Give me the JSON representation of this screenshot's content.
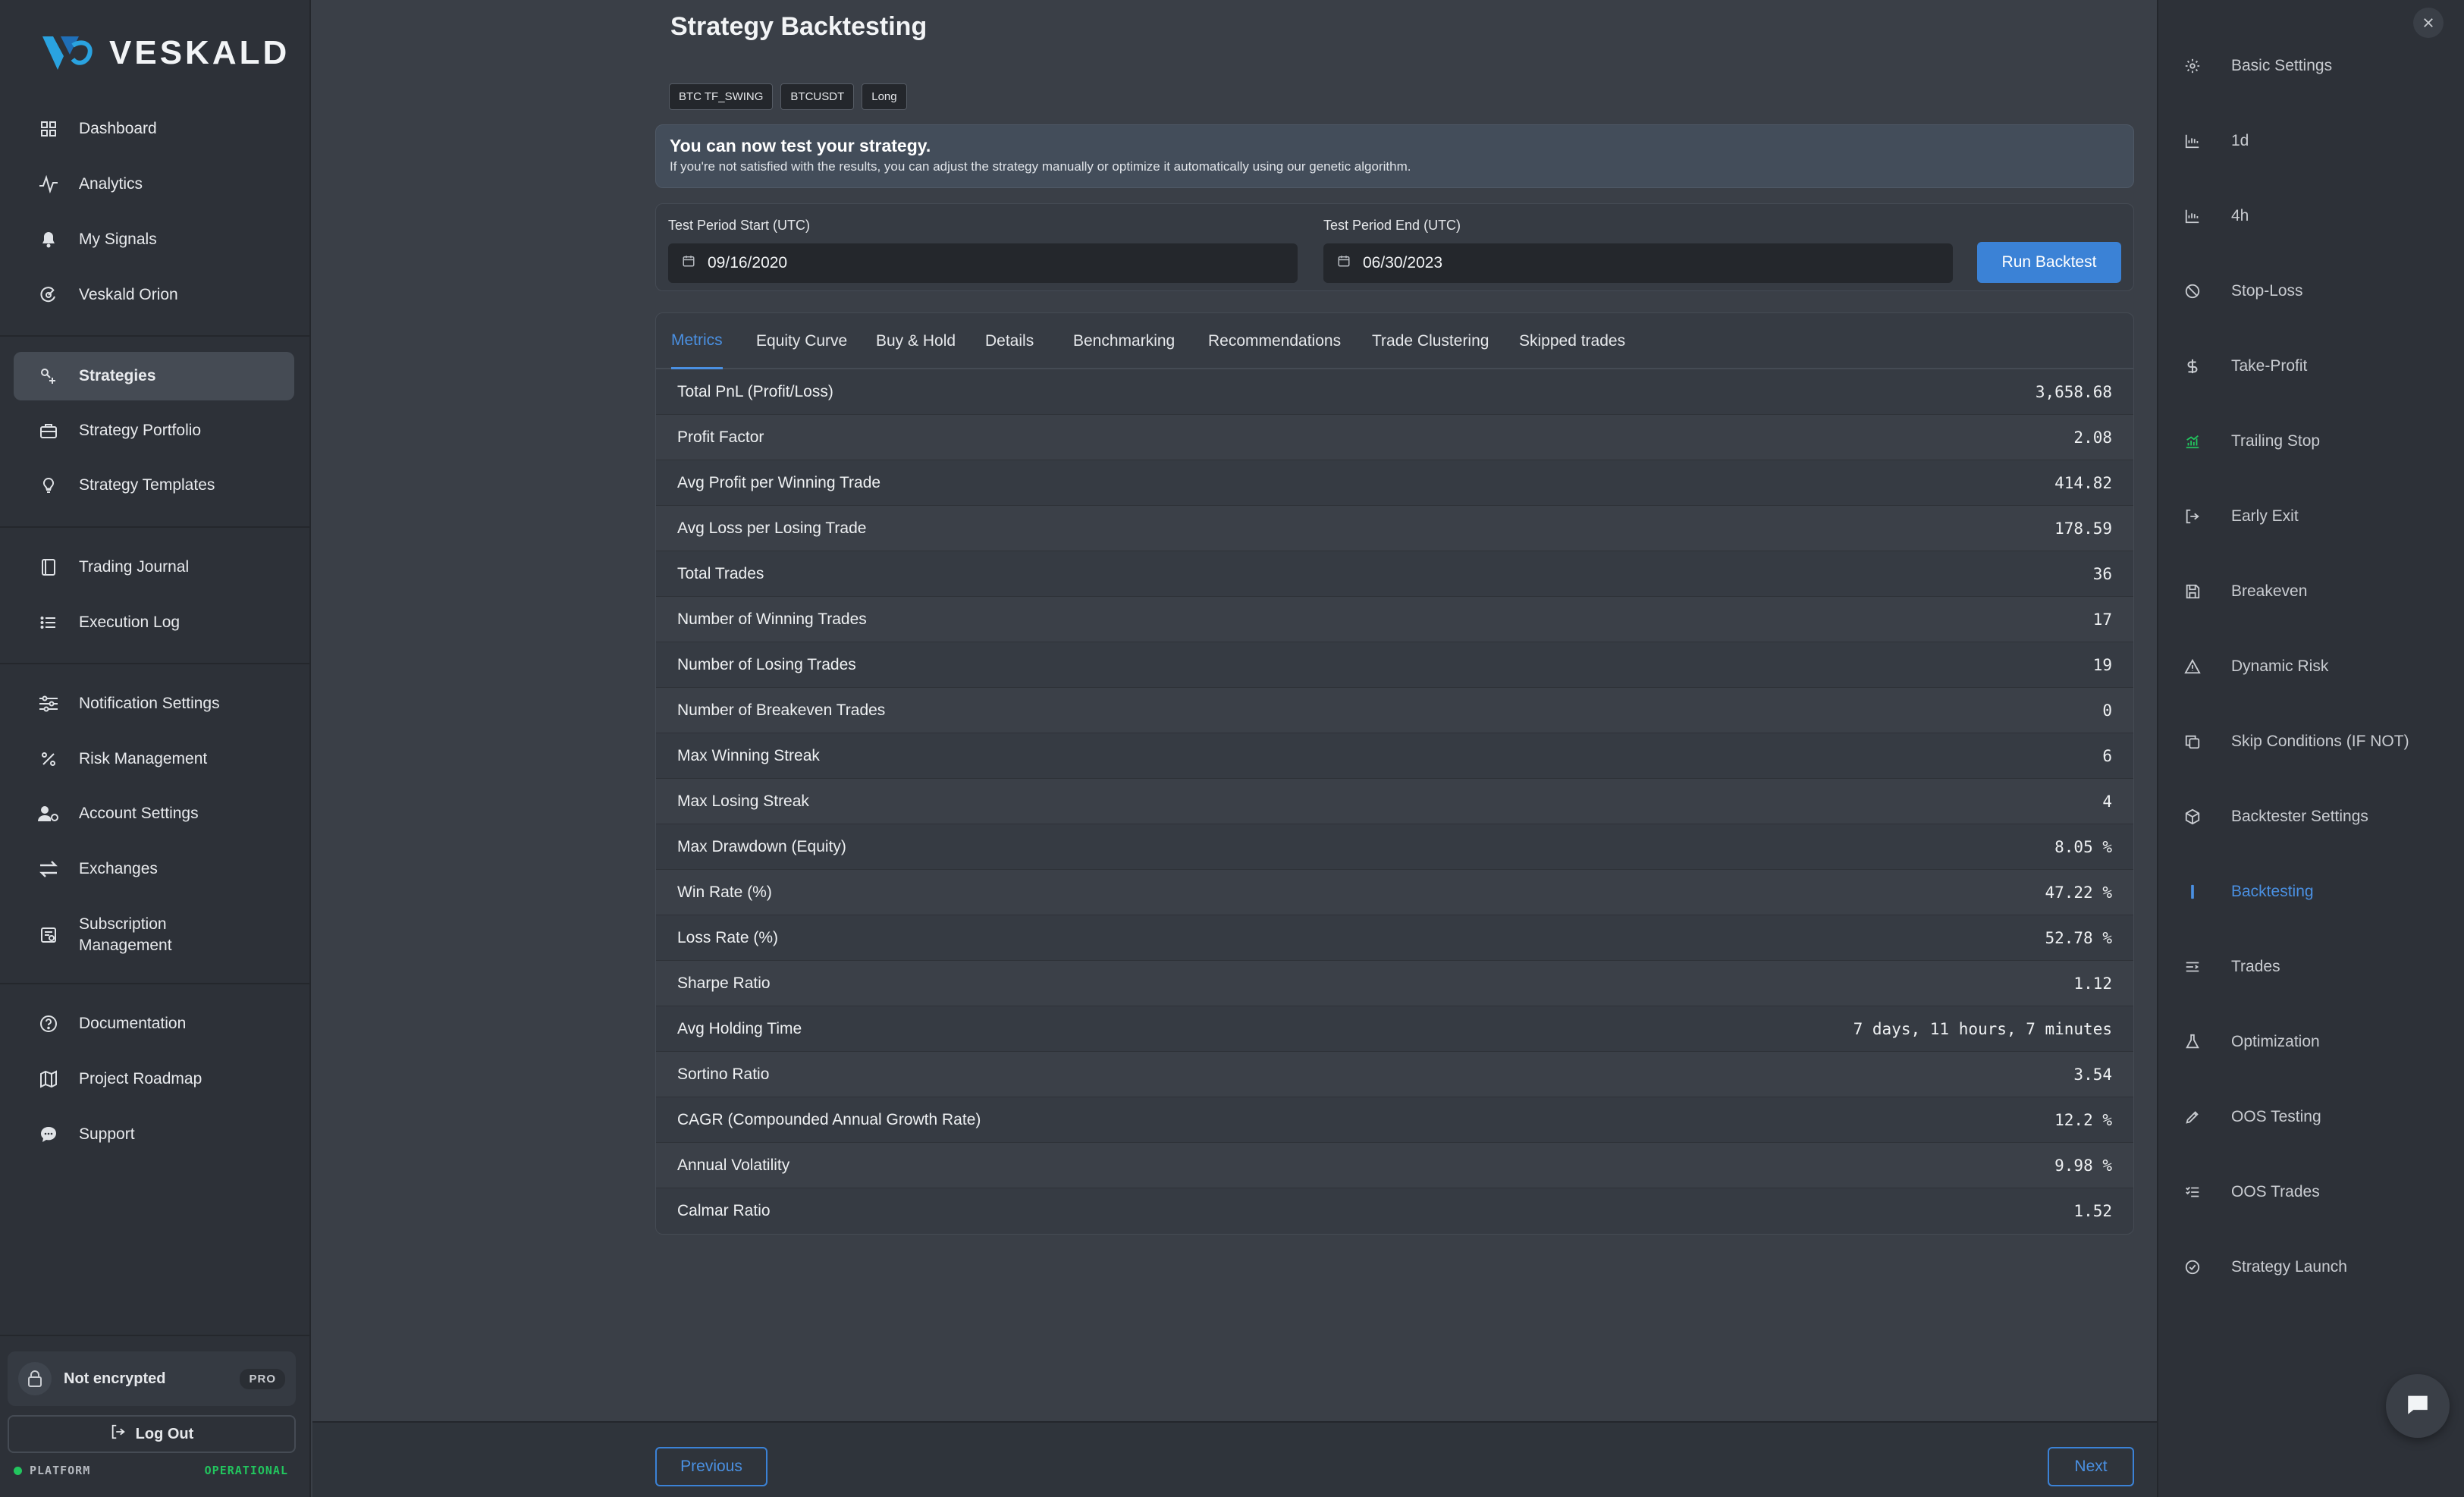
{
  "brand": {
    "name": "VESKALD"
  },
  "sidebar": {
    "items": [
      {
        "label": "Dashboard",
        "icon": "dashboard-icon"
      },
      {
        "label": "Analytics",
        "icon": "analytics-icon"
      },
      {
        "label": "My Signals",
        "icon": "bell-icon"
      },
      {
        "label": "Veskald Orion",
        "icon": "orion-icon"
      },
      {
        "label": "Strategies",
        "icon": "strategies-icon",
        "active": true
      },
      {
        "label": "Strategy Portfolio",
        "icon": "briefcase-icon"
      },
      {
        "label": "Strategy Templates",
        "icon": "lightbulb-icon"
      },
      {
        "label": "Trading Journal",
        "icon": "journal-icon"
      },
      {
        "label": "Execution Log",
        "icon": "list-icon"
      },
      {
        "label": "Notification Settings",
        "icon": "sliders-icon"
      },
      {
        "label": "Risk Management",
        "icon": "percent-icon"
      },
      {
        "label": "Account Settings",
        "icon": "user-gear-icon"
      },
      {
        "label": "Exchanges",
        "icon": "exchange-icon"
      },
      {
        "label": "Subscription Management",
        "icon": "subscription-icon"
      },
      {
        "label": "Documentation",
        "icon": "help-circle-icon"
      },
      {
        "label": "Project Roadmap",
        "icon": "map-icon"
      },
      {
        "label": "Support",
        "icon": "chat-icon"
      }
    ],
    "encryption": {
      "label": "Not encrypted",
      "badge": "PRO"
    },
    "logout_label": "Log Out",
    "status": {
      "left": "PLATFORM",
      "right": "OPERATIONAL",
      "color": "#22c55e"
    }
  },
  "main": {
    "title": "Strategy Backtesting",
    "tags": [
      "BTC TF_SWING",
      "BTCUSDT",
      "Long"
    ],
    "info": {
      "title": "You can now test your strategy.",
      "subtitle": "If you're not satisfied with the results, you can adjust the strategy manually or optimize it automatically using our genetic algorithm."
    },
    "dates": {
      "start_label": "Test Period Start (UTC)",
      "start_value": "09/16/2020",
      "end_label": "Test Period End (UTC)",
      "end_value": "06/30/2023",
      "run_label": "Run Backtest"
    },
    "tabs": [
      "Metrics",
      "Equity Curve",
      "Buy & Hold",
      "Details",
      "Benchmarking",
      "Recommendations",
      "Trade Clustering",
      "Skipped trades"
    ],
    "active_tab": "Metrics",
    "metrics": [
      {
        "label": "Total PnL (Profit/Loss)",
        "value": "3,658.68"
      },
      {
        "label": "Profit Factor",
        "value": "2.08"
      },
      {
        "label": "Avg Profit per Winning Trade",
        "value": "414.82"
      },
      {
        "label": "Avg Loss per Losing Trade",
        "value": "178.59"
      },
      {
        "label": "Total Trades",
        "value": "36"
      },
      {
        "label": "Number of Winning Trades",
        "value": "17"
      },
      {
        "label": "Number of Losing Trades",
        "value": "19"
      },
      {
        "label": "Number of Breakeven Trades",
        "value": "0"
      },
      {
        "label": "Max Winning Streak",
        "value": "6"
      },
      {
        "label": "Max Losing Streak",
        "value": "4"
      },
      {
        "label": "Max Drawdown (Equity)",
        "value": "8.05 %"
      },
      {
        "label": "Win Rate (%)",
        "value": "47.22 %"
      },
      {
        "label": "Loss Rate (%)",
        "value": "52.78 %"
      },
      {
        "label": "Sharpe Ratio",
        "value": "1.12"
      },
      {
        "label": "Avg Holding Time",
        "value": "7 days, 11 hours, 7 minutes"
      },
      {
        "label": "Sortino Ratio",
        "value": "3.54"
      },
      {
        "label": "CAGR (Compounded Annual Growth Rate)",
        "value": "12.2 %"
      },
      {
        "label": "Annual Volatility",
        "value": "9.98 %"
      },
      {
        "label": "Calmar Ratio",
        "value": "1.52"
      }
    ],
    "previous_label": "Previous",
    "next_label": "Next",
    "accent": "#3b82d6"
  },
  "steps": {
    "items": [
      {
        "label": "Basic Settings",
        "icon": "gear-icon"
      },
      {
        "label": "1d",
        "icon": "chart-icon"
      },
      {
        "label": "4h",
        "icon": "chart-icon"
      },
      {
        "label": "Stop-Loss",
        "icon": "stop-icon"
      },
      {
        "label": "Take-Profit",
        "icon": "dollar-icon"
      },
      {
        "label": "Trailing Stop",
        "icon": "trailing-chart-icon"
      },
      {
        "label": "Early Exit",
        "icon": "exit-icon"
      },
      {
        "label": "Breakeven",
        "icon": "save-icon"
      },
      {
        "label": "Dynamic Risk",
        "icon": "warning-icon"
      },
      {
        "label": "Skip Conditions (IF NOT)",
        "icon": "copy-icon"
      },
      {
        "label": "Backtester Settings",
        "icon": "cube-icon"
      },
      {
        "label": "Backtesting",
        "icon": "bar-icon",
        "active": true
      },
      {
        "label": "Trades",
        "icon": "trades-list-icon"
      },
      {
        "label": "Optimization",
        "icon": "flask-icon"
      },
      {
        "label": "OOS Testing",
        "icon": "pencil-icon"
      },
      {
        "label": "OOS Trades",
        "icon": "checklist-icon"
      },
      {
        "label": "Strategy Launch",
        "icon": "check-circle-icon"
      }
    ]
  }
}
